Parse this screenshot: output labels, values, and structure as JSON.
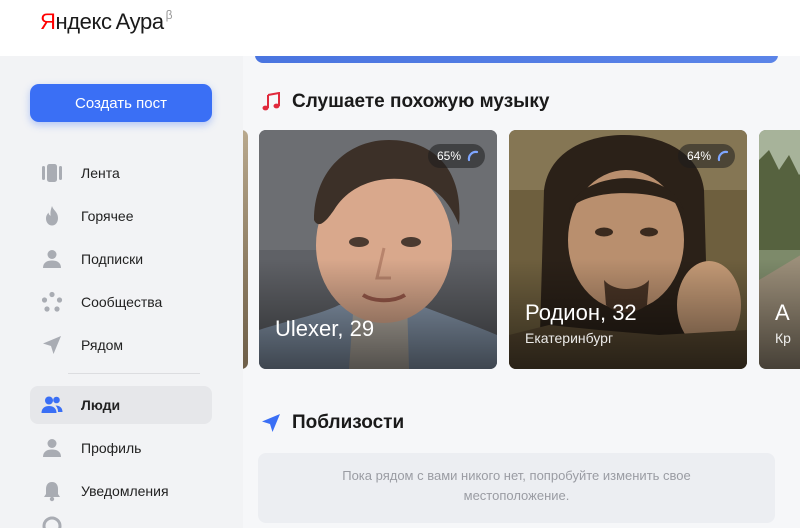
{
  "header": {
    "logo_ya": "Я",
    "logo_rest": "ндекс",
    "logo_aura": "Аура",
    "logo_beta": "β"
  },
  "sidebar": {
    "create_post": "Создать пост",
    "items": [
      {
        "label": "Лента",
        "icon": "feed-icon",
        "active": false
      },
      {
        "label": "Горячее",
        "icon": "fire-icon",
        "active": false
      },
      {
        "label": "Подписки",
        "icon": "user-icon",
        "active": false
      },
      {
        "label": "Сообщества",
        "icon": "communities-icon",
        "active": false
      },
      {
        "label": "Рядом",
        "icon": "location-arrow-icon",
        "active": false
      },
      {
        "label": "Люди",
        "icon": "people-icon",
        "active": true
      },
      {
        "label": "Профиль",
        "icon": "profile-icon",
        "active": false
      },
      {
        "label": "Уведомления",
        "icon": "bell-icon",
        "active": false
      }
    ]
  },
  "main": {
    "music_section": {
      "title": "Слушаете похожую музыку",
      "icon": "music-note-icon",
      "cards": [
        {
          "name": "Ulexer, 29",
          "city": "",
          "match": "65%"
        },
        {
          "name": "Родион, 32",
          "city": "Екатеринбург",
          "match": "64%"
        },
        {
          "name": "А",
          "city": "Кр",
          "match": ""
        }
      ]
    },
    "nearby_section": {
      "title": "Поблизости",
      "icon": "location-arrow-icon",
      "empty_text": "Пока рядом с вами никого нет, попробуйте изменить свое местоположение."
    }
  },
  "colors": {
    "accent": "#3a6ff5",
    "sidebar_bg": "#f2f3f5",
    "main_bg": "#f6f7f9",
    "music_icon": "#e0293c",
    "nearby_icon": "#3a6ff5"
  }
}
